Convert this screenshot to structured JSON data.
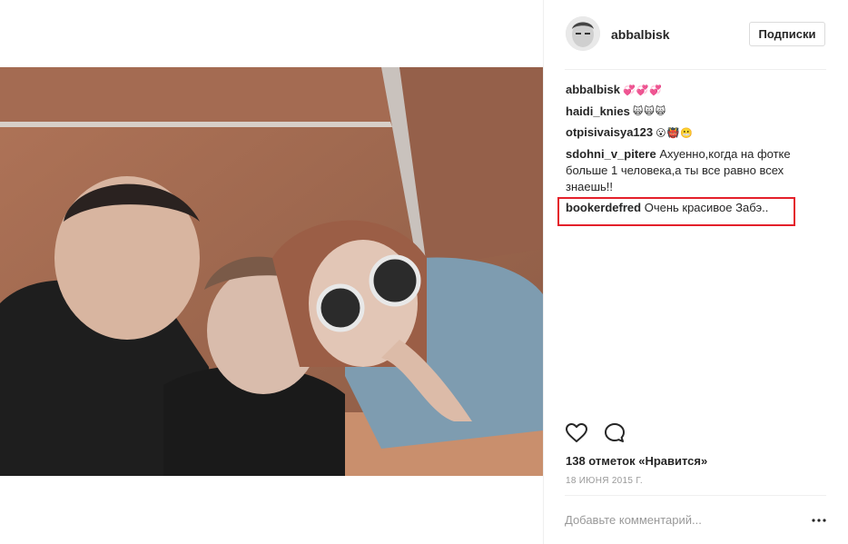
{
  "post": {
    "author": "abbalbisk",
    "follow_label": "Подписки"
  },
  "comments": [
    {
      "user": "abbalbisk",
      "text": "",
      "emoji": "💞💞💞",
      "emoji_color": "#e0245e"
    },
    {
      "user": "haidi_knies",
      "text": "",
      "emoji": "🙀🙀🙀",
      "emoji_color": "#8a8a8a"
    },
    {
      "user": "otpisivaisya123",
      "text": "",
      "emoji": "😮👹😬",
      "emoji_color": "#d4a017"
    },
    {
      "user": "sdohni_v_pitere",
      "text": "Ахуенно,когда на фотке больше 1 человека,а ты все равно всех знаешь!!"
    },
    {
      "user": "bookerdefred",
      "text": "Очень красивое Забэ.."
    }
  ],
  "actions": {
    "like_icon": "heart-icon",
    "comment_icon": "comment-bubble-icon"
  },
  "likes_text": "138 отметок «Нравится»",
  "date": "18 ИЮНЯ 2015 Г.",
  "comment_box": {
    "placeholder": "Добавьте комментарий...",
    "more_icon": "more-options-icon"
  },
  "highlight_color": "#e4202a"
}
